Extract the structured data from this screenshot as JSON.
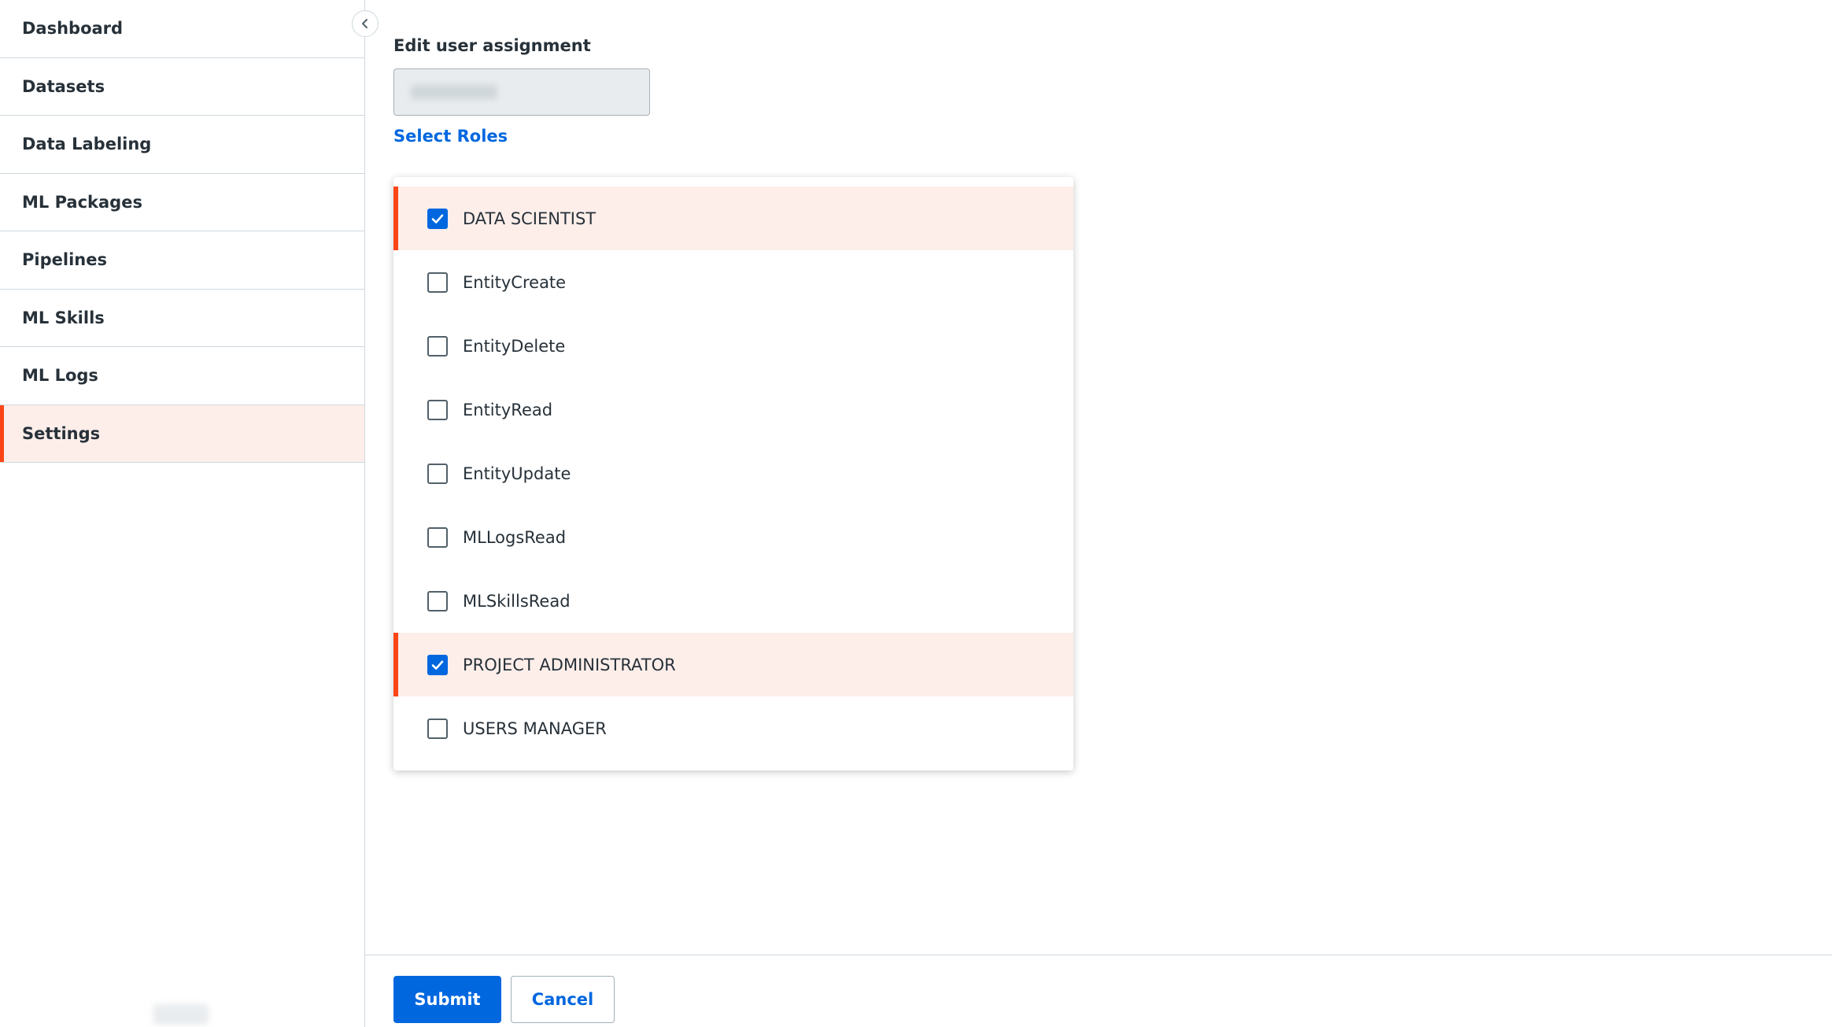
{
  "sidebar": {
    "items": [
      {
        "label": "Dashboard",
        "active": false
      },
      {
        "label": "Datasets",
        "active": false
      },
      {
        "label": "Data Labeling",
        "active": false
      },
      {
        "label": "ML Packages",
        "active": false
      },
      {
        "label": "Pipelines",
        "active": false
      },
      {
        "label": "ML Skills",
        "active": false
      },
      {
        "label": "ML Logs",
        "active": false
      },
      {
        "label": "Settings",
        "active": true
      }
    ],
    "collapse_icon": "chevron-left-icon"
  },
  "form": {
    "title": "Edit user assignment",
    "user_value": "",
    "select_roles_label": "Select Roles"
  },
  "roles": [
    {
      "label": "DATA SCIENTIST",
      "checked": true
    },
    {
      "label": "EntityCreate",
      "checked": false
    },
    {
      "label": "EntityDelete",
      "checked": false
    },
    {
      "label": "EntityRead",
      "checked": false
    },
    {
      "label": "EntityUpdate",
      "checked": false
    },
    {
      "label": "MLLogsRead",
      "checked": false
    },
    {
      "label": "MLSkillsRead",
      "checked": false
    },
    {
      "label": "PROJECT ADMINISTRATOR",
      "checked": true
    },
    {
      "label": "USERS MANAGER",
      "checked": false
    }
  ],
  "footer": {
    "submit_label": "Submit",
    "cancel_label": "Cancel"
  },
  "colors": {
    "accent": "#fa4616",
    "primary": "#0067df",
    "selected_bg": "#fdeeea"
  }
}
